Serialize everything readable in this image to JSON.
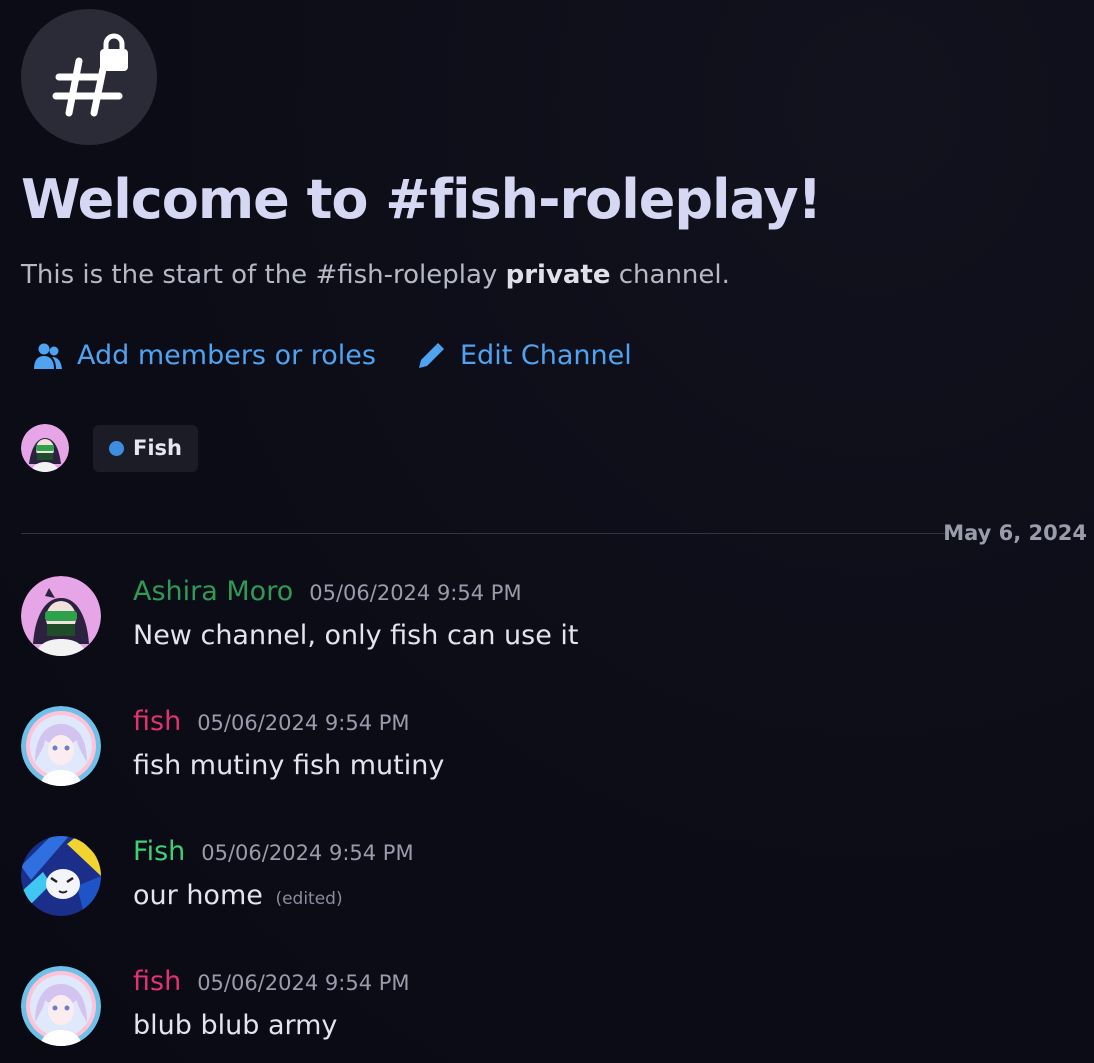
{
  "channel": {
    "icon": "hashtag-lock-icon",
    "welcome_title": "Welcome to #fish-roleplay!",
    "subtitle_before": "This is the start of the #fish-roleplay ",
    "subtitle_bold": "private",
    "subtitle_after": " channel."
  },
  "actions": [
    {
      "label": "Add members or roles",
      "icon": "add-members-icon"
    },
    {
      "label": "Edit Channel",
      "icon": "pencil-icon"
    }
  ],
  "members": {
    "role_name": "Fish",
    "role_color": "#3d8ee0"
  },
  "date_divider": "May 6, 2024",
  "messages": [
    {
      "author": "Ashira Moro",
      "author_color": "#2f9a55",
      "time": "05/06/2024 9:54 PM",
      "text": "New channel, only fish can use it",
      "edited": ""
    },
    {
      "author": "fish",
      "author_color": "#e3326e",
      "time": "05/06/2024 9:54 PM",
      "text": "fish mutiny fish mutiny",
      "edited": ""
    },
    {
      "author": "Fish",
      "author_color": "#3fcf76",
      "time": "05/06/2024 9:54 PM",
      "text": "our home",
      "edited": "(edited)"
    },
    {
      "author": "fish",
      "author_color": "#e3326e",
      "time": "05/06/2024 9:54 PM",
      "text": "blub blub army",
      "edited": ""
    }
  ]
}
